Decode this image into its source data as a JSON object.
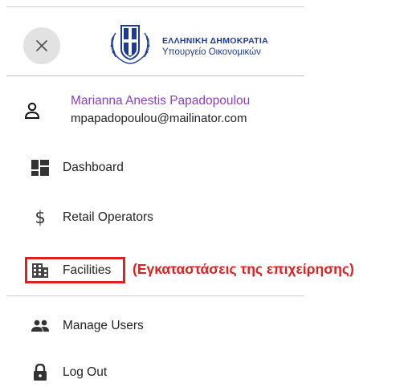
{
  "header": {
    "close_icon": "close-icon",
    "logo_icon": "greek-coat-of-arms",
    "brand_title": "ΕΛΛΗΝΙΚΗ ΔΗΜΟΚΡΑΤΙΑ",
    "brand_subtitle": "Υπουργείο Οικονομικών"
  },
  "user": {
    "name": "Marianna Anestis Papadopoulou",
    "email": "mpapadopoulou@mailinator.com",
    "icon": "person-icon"
  },
  "nav": [
    {
      "label": "Dashboard",
      "icon": "dashboard-icon"
    },
    {
      "label": "Retail Operators",
      "icon": "dollar-icon"
    },
    {
      "label": "Facilities",
      "icon": "building-icon"
    },
    {
      "label": "Manage Users",
      "icon": "users-icon"
    },
    {
      "label": "Log Out",
      "icon": "lock-icon"
    }
  ],
  "annotation": {
    "text": "(Εγκαταστάσεις της επιχείρησης)",
    "color": "#e02020"
  },
  "colors": {
    "user_name": "#8a3ec8",
    "brand": "#1f3b8f"
  }
}
